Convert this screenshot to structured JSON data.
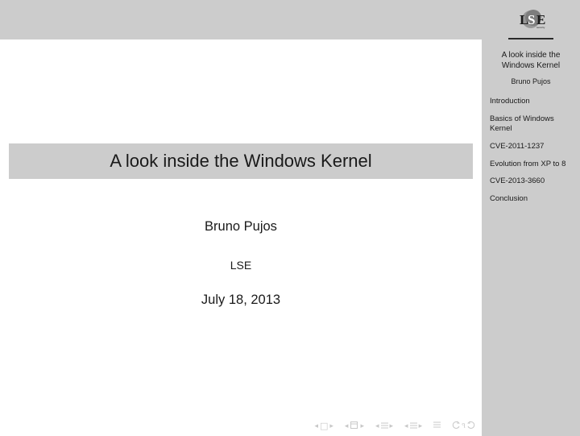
{
  "slide": {
    "title": "A look inside the Windows Kernel",
    "author": "Bruno Pujos",
    "institute": "LSE",
    "date": "July 18, 2013"
  },
  "sidebar": {
    "logo_text": "LSE",
    "title_line1": "A look inside the",
    "title_line2": "Windows Kernel",
    "author": "Bruno Pujos",
    "nav": [
      "Introduction",
      "Basics of Windows Kernel",
      "CVE-2011-1237",
      "Evolution from XP to 8",
      "CVE-2013-3660",
      "Conclusion"
    ]
  },
  "controls": {
    "first": "◂ □ ▸",
    "prev": "◂ ⌧ ▸",
    "back": "◂ ≡ ▸",
    "fwd": "◂ ≡ ▸",
    "mode": "≡",
    "undo": "↩",
    "search": "૧",
    "redo": "↪"
  }
}
